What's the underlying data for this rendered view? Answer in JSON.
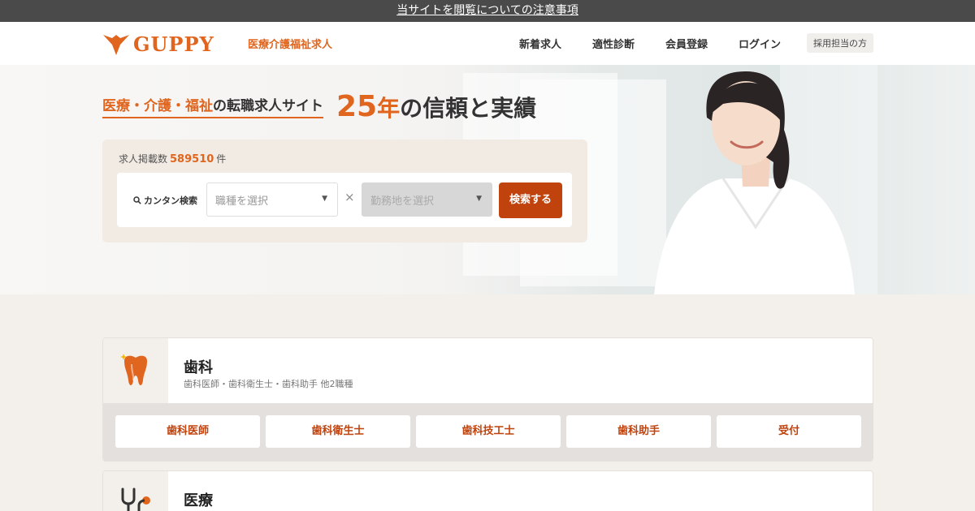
{
  "notice": {
    "text": "当サイトを閲覧についての注意事項"
  },
  "header": {
    "logo_text": "GUPPY",
    "tagline": "医療介護福祉求人",
    "nav": [
      "新着求人",
      "適性診断",
      "会員登録",
      "ログイン"
    ],
    "recruiter_button": "採用担当の方"
  },
  "hero": {
    "headline_accent_1": "医療",
    "headline_sep_1": "・",
    "headline_accent_2": "介護",
    "headline_sep_2": "・",
    "headline_accent_3": "福祉",
    "headline_rest": "の転職求人サイト",
    "years_number": "25",
    "years_unit": "年",
    "headline_right": "の信頼と実績"
  },
  "search": {
    "count_label": "求人掲載数",
    "count_value": "589510",
    "count_unit": "件",
    "quick_label": "カンタン検索",
    "job_type_placeholder": "職種を選択",
    "location_placeholder": "勤務地を選択",
    "times": "×",
    "button": "検索する"
  },
  "categories": [
    {
      "title": "歯科",
      "subtitle": "歯科医師・歯科衛生士・歯科助手 他2職種",
      "icon": "tooth-icon",
      "items": [
        "歯科医師",
        "歯科衛生士",
        "歯科技工士",
        "歯科助手",
        "受付"
      ]
    },
    {
      "title": "医療",
      "icon": "stethoscope-icon"
    }
  ],
  "colors": {
    "accent": "#e0651e",
    "button": "#c0420c",
    "notice_bg": "#4a4a4a"
  }
}
